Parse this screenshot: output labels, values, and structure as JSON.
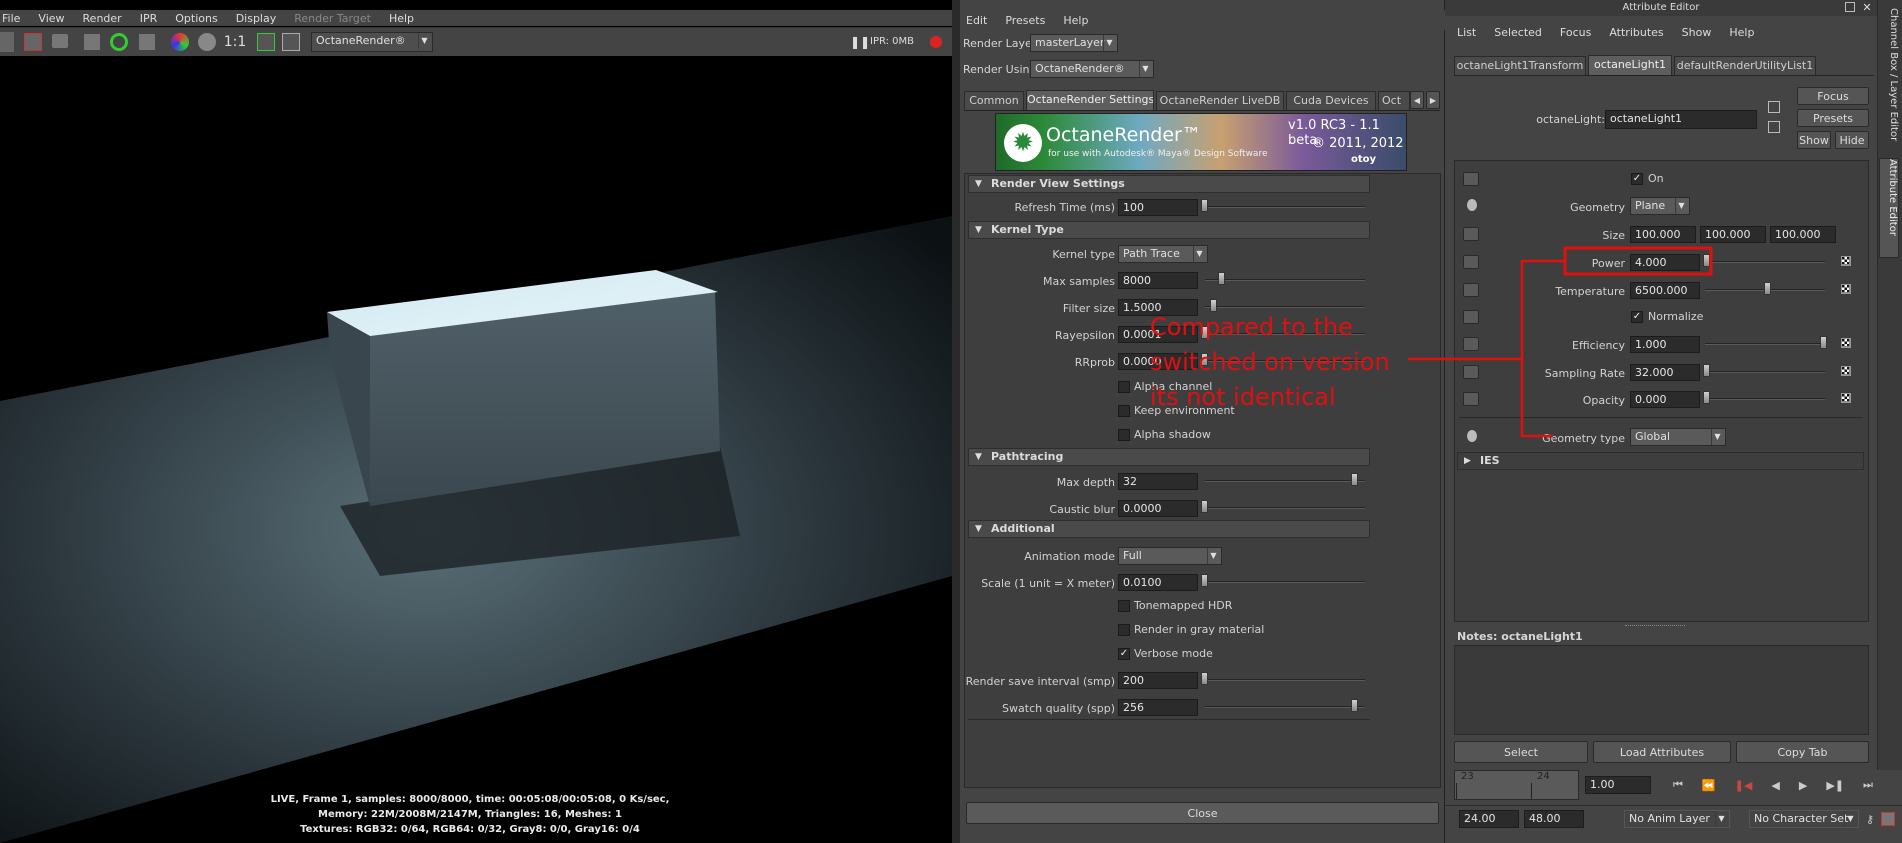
{
  "render_view": {
    "menu": [
      "File",
      "View",
      "Render",
      "IPR",
      "Options",
      "Display",
      "Render Target",
      "Help"
    ],
    "ratio_label": "1:1",
    "renderer": "OctaneRender®",
    "ipr_status": "IPR: 0MB",
    "status_lines": [
      "LIVE, Frame 1, samples: 8000/8000, time: 00:05:08/00:05:08, 0 Ks/sec,",
      "Memory: 22M/2008M/2147M, Triangles: 16, Meshes: 1",
      "Textures: RGB32: 0/64, RGB64: 0/32, Gray8: 0/0, Gray16: 0/4"
    ]
  },
  "render_settings": {
    "menu": [
      "Edit",
      "Presets",
      "Help"
    ],
    "render_layer_label": "Render Layer",
    "render_layer_value": "masterLayer",
    "render_using_label": "Render Using",
    "render_using_value": "OctaneRender®",
    "tabs": [
      "Common",
      "OctaneRender Settings",
      "OctaneRender LiveDB",
      "Cuda Devices",
      "Oct"
    ],
    "banner": {
      "product": "OctaneRender™",
      "tagline": "for use with Autodesk® Maya® Design Software",
      "version": "v1.0 RC3 - 1.1 beta",
      "copyright": "® 2011, 2012",
      "brand": "otoy"
    },
    "sections": {
      "render_view": "Render View Settings",
      "kernel": "Kernel Type",
      "pathtracing": "Pathtracing",
      "additional": "Additional"
    },
    "fields": {
      "refresh_time": {
        "label": "Refresh Time (ms)",
        "value": "100"
      },
      "kernel_type": {
        "label": "Kernel type",
        "value": "Path Trace"
      },
      "max_samples": {
        "label": "Max samples",
        "value": "8000"
      },
      "filter_size": {
        "label": "Filter size",
        "value": "1.5000"
      },
      "rayepsilon": {
        "label": "Rayepsilon",
        "value": "0.0001"
      },
      "rrprob": {
        "label": "RRprob",
        "value": "0.0000"
      },
      "max_depth": {
        "label": "Max depth",
        "value": "32"
      },
      "caustic_blur": {
        "label": "Caustic blur",
        "value": "0.0000"
      },
      "animation_mode": {
        "label": "Animation mode",
        "value": "Full"
      },
      "scale": {
        "label": "Scale (1 unit = X meter)",
        "value": "0.0100"
      },
      "render_save_interval": {
        "label": "Render save interval (smp)",
        "value": "200"
      },
      "swatch_quality": {
        "label": "Swatch quality (spp)",
        "value": "256"
      }
    },
    "checkboxes": {
      "alpha_channel": "Alpha channel",
      "keep_environment": "Keep environment",
      "alpha_shadow": "Alpha shadow",
      "tonemapped_hdr": "Tonemapped HDR",
      "render_gray": "Render in gray material",
      "verbose": "Verbose mode"
    },
    "close_label": "Close"
  },
  "annotation": {
    "lines": [
      "Compared to the",
      "switched on version",
      "its not identical"
    ],
    "color": "#e01010"
  },
  "attribute_editor": {
    "title": "Attribute Editor",
    "menu": [
      "List",
      "Selected",
      "Focus",
      "Attributes",
      "Show",
      "Help"
    ],
    "tabs": [
      "octaneLight1Transform",
      "octaneLight1",
      "defaultRenderUtilityList1"
    ],
    "node_label": "octaneLight:",
    "node_value": "octaneLight1",
    "side_buttons": {
      "focus": "Focus",
      "presets": "Presets",
      "show": "Show",
      "hide": "Hide"
    },
    "on_label": "On",
    "geometry": {
      "label": "Geometry",
      "value": "Plane"
    },
    "size": {
      "label": "Size",
      "x": "100.000",
      "y": "100.000",
      "z": "100.000"
    },
    "power": {
      "label": "Power",
      "value": "4.000"
    },
    "temperature": {
      "label": "Temperature",
      "value": "6500.000"
    },
    "normalize_label": "Normalize",
    "efficiency": {
      "label": "Efficiency",
      "value": "1.000"
    },
    "sampling_rate": {
      "label": "Sampling Rate",
      "value": "32.000"
    },
    "opacity": {
      "label": "Opacity",
      "value": "0.000"
    },
    "geometry_type": {
      "label": "Geometry type",
      "value": "Global"
    },
    "ies_label": "IES",
    "notes_label": "Notes:  octaneLight1",
    "bottom_buttons": {
      "select": "Select",
      "load": "Load Attributes",
      "copy": "Copy Tab"
    },
    "vertical_tabs": [
      "Channel Box / Layer Editor",
      "Attribute Editor"
    ]
  },
  "timeline": {
    "ticks": [
      "23",
      "24"
    ],
    "current_frame": "1.00",
    "start": "24.00",
    "end": "48.00",
    "anim_layer": "No Anim Layer",
    "character_set": "No Character Set"
  }
}
